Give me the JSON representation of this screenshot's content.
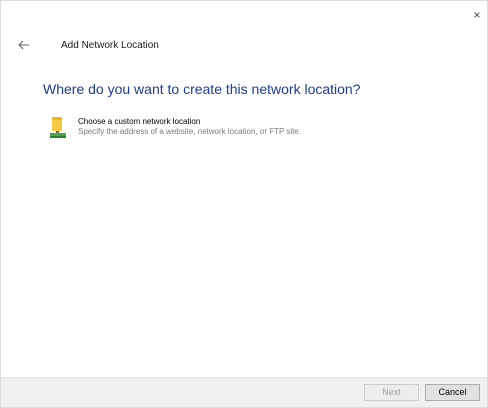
{
  "window": {
    "close_glyph": "×"
  },
  "header": {
    "back_icon": "back-arrow-icon",
    "title": "Add Network Location"
  },
  "main": {
    "heading": "Where do you want to create this network location?",
    "options": [
      {
        "icon": "network-location-icon",
        "title": "Choose a custom network location",
        "description": "Specify the address of a website, network location, or FTP site."
      }
    ]
  },
  "footer": {
    "next_label": "Next",
    "next_enabled": false,
    "cancel_label": "Cancel"
  },
  "colors": {
    "heading": "#1e3a9a",
    "footer_bg": "#f0f0f0",
    "disabled_text": "#a0a0a0"
  }
}
